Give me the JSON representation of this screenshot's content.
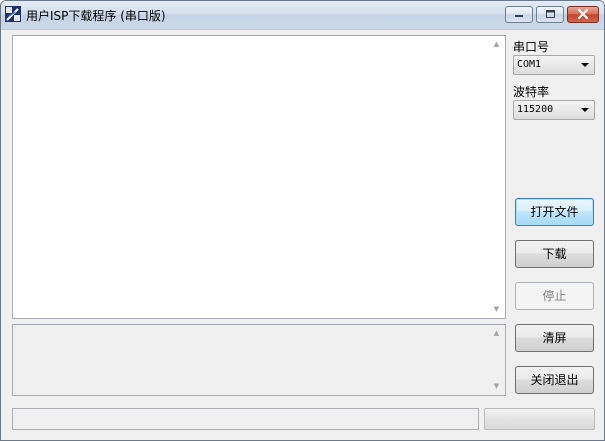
{
  "window": {
    "title": "用户ISP下载程序 (串口版)"
  },
  "icons": {
    "app": "app-icon",
    "minimize": "minimize-icon",
    "maximize": "maximize-icon",
    "close": "close-icon",
    "dropdown": "chevron-down-icon",
    "scroll_up": "scroll-up-arrow-icon",
    "scroll_down": "scroll-down-arrow-icon"
  },
  "colors": {
    "default_button_border": "#3c7fb1",
    "close_button": "#c4442a"
  },
  "serial": {
    "port_label": "串口号",
    "port_value": "COM1",
    "baud_label": "波特率",
    "baud_value": "115200"
  },
  "buttons": {
    "open_file": "打开文件",
    "download": "下载",
    "stop": "停止",
    "clear": "清屏",
    "exit": "关闭退出"
  },
  "log": {
    "text": "",
    "info_text": ""
  },
  "status": {
    "text": "",
    "progress": 0
  }
}
